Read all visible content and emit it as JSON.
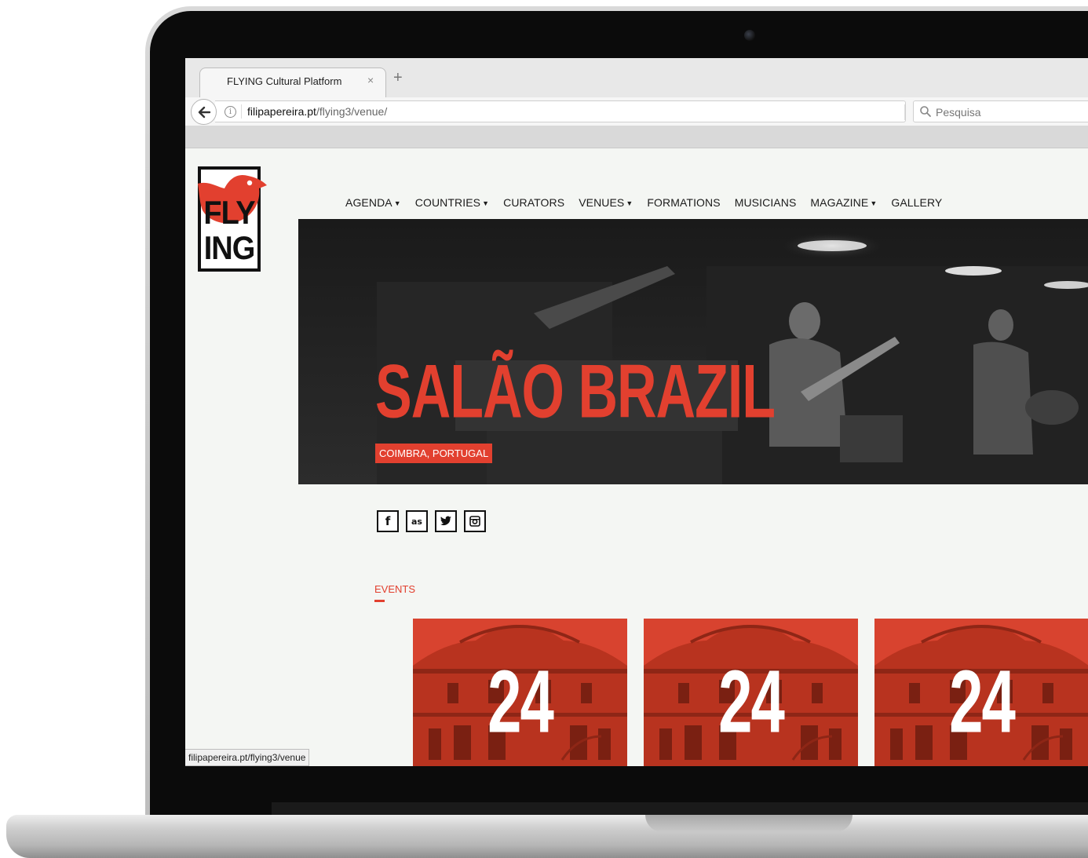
{
  "browser": {
    "tab_title": "FLYING Cultural Platform",
    "tab_close": "×",
    "new_tab": "+",
    "url_domain": "filipapereira.pt",
    "url_path": "/flying3/venue/",
    "search_placeholder": "Pesquisa",
    "status_url": "filipapereira.pt/flying3/venue"
  },
  "logo": {
    "line1": "FLY",
    "line2": "ING"
  },
  "nav": {
    "items": [
      {
        "label": "AGENDA",
        "caret": true
      },
      {
        "label": "COUNTRIES",
        "caret": true
      },
      {
        "label": "CURATORS",
        "caret": false
      },
      {
        "label": "VENUES",
        "caret": true
      },
      {
        "label": "FORMATIONS",
        "caret": false
      },
      {
        "label": "MUSICIANS",
        "caret": false
      },
      {
        "label": "MAGAZINE",
        "caret": true
      },
      {
        "label": "GALLERY",
        "caret": false
      }
    ]
  },
  "hero": {
    "title": "SALÃO BRAZIL",
    "location": "COIMBRA, PORTUGAL"
  },
  "socials": [
    {
      "icon": "facebook-icon",
      "glyph": "f"
    },
    {
      "icon": "lastfm-icon",
      "glyph": "as"
    },
    {
      "icon": "twitter-icon",
      "glyph": "t"
    },
    {
      "icon": "instagram-icon",
      "glyph": "◙"
    }
  ],
  "events": {
    "label": "EVENTS",
    "cards": [
      {
        "day": "24"
      },
      {
        "day": "24"
      },
      {
        "day": "24"
      }
    ]
  },
  "colors": {
    "accent": "#e2402f",
    "page_bg": "#f4f6f3"
  }
}
